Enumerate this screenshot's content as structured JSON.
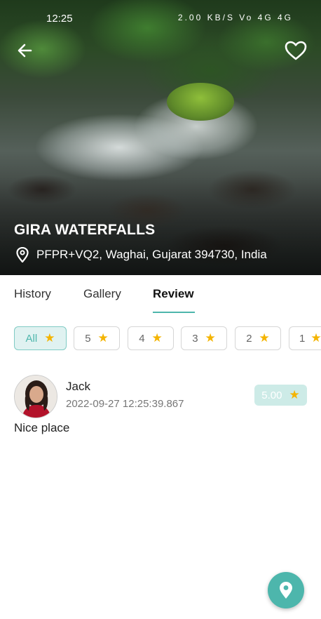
{
  "status_bar": {
    "time": "12:25",
    "icons_text": "2.00 KB/S Vo 4G 4G"
  },
  "hero": {
    "title": "GIRA WATERFALLS",
    "address": "PFPR+VQ2, Waghai, Gujarat 394730, India",
    "back_icon": "back-arrow-icon",
    "favorite_icon": "heart-outline-icon"
  },
  "tabs": [
    {
      "label": "History",
      "active": false
    },
    {
      "label": "Gallery",
      "active": false
    },
    {
      "label": "Review",
      "active": true
    }
  ],
  "filters": [
    {
      "label": "All",
      "active": true
    },
    {
      "label": "5",
      "active": false
    },
    {
      "label": "4",
      "active": false
    },
    {
      "label": "3",
      "active": false
    },
    {
      "label": "2",
      "active": false
    },
    {
      "label": "1",
      "active": false
    }
  ],
  "review": {
    "name": "Jack",
    "date": "2022-09-27 12:25:39.867",
    "rating": "5.00",
    "text": "Nice place"
  },
  "colors": {
    "accent": "#4db6ac",
    "accent_light": "#e0f2f1",
    "star": "#f4b400"
  },
  "fab": {
    "icon": "location-pin-icon"
  }
}
